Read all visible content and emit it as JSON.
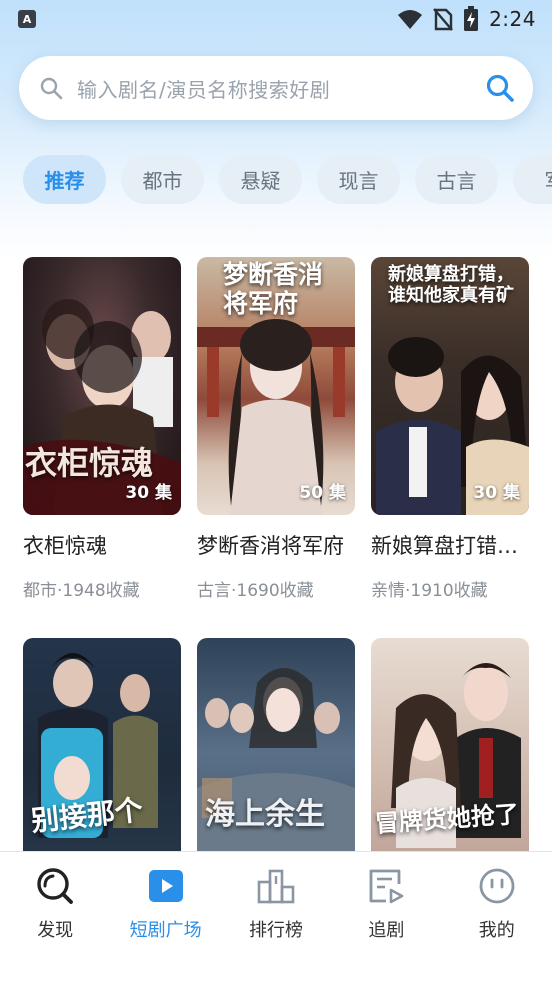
{
  "status_bar": {
    "app_badge": "A",
    "time": "2:24"
  },
  "search": {
    "placeholder": "输入剧名/演员名称搜索好剧"
  },
  "categories": [
    {
      "label": "推荐",
      "active": true
    },
    {
      "label": "都市",
      "active": false
    },
    {
      "label": "悬疑",
      "active": false
    },
    {
      "label": "现言",
      "active": false
    },
    {
      "label": "古言",
      "active": false
    },
    {
      "label": "军",
      "active": false
    }
  ],
  "dramas": [
    {
      "title": "衣柜惊魂",
      "episodes": "30 集",
      "meta": "都市·1948收藏",
      "poster_text": "衣柜惊魂"
    },
    {
      "title": "梦断香消将军府",
      "episodes": "50 集",
      "meta": "古言·1690收藏",
      "poster_text": "梦断香消将军府"
    },
    {
      "title": "新娘算盘打错…",
      "episodes": "30 集",
      "meta": "亲情·1910收藏",
      "poster_text": "新娘算盘打错，谁知他家真有矿"
    },
    {
      "title": "",
      "episodes": "",
      "meta": "",
      "poster_text": "别接那个"
    },
    {
      "title": "",
      "episodes": "",
      "meta": "",
      "poster_text": "海上余生"
    },
    {
      "title": "",
      "episodes": "",
      "meta": "",
      "poster_text": "冒牌货她抢了"
    }
  ],
  "bottom_nav": [
    {
      "label": "发现",
      "icon": "discover-icon",
      "active": false
    },
    {
      "label": "短剧广场",
      "icon": "play-square-icon",
      "active": true
    },
    {
      "label": "排行榜",
      "icon": "ranking-icon",
      "active": false
    },
    {
      "label": "追剧",
      "icon": "follow-icon",
      "active": false
    },
    {
      "label": "我的",
      "icon": "profile-icon",
      "active": false
    }
  ],
  "colors": {
    "accent": "#2a8fe8",
    "chip_bg": "#e6eef6",
    "chip_active_bg": "#cfe6fa"
  }
}
